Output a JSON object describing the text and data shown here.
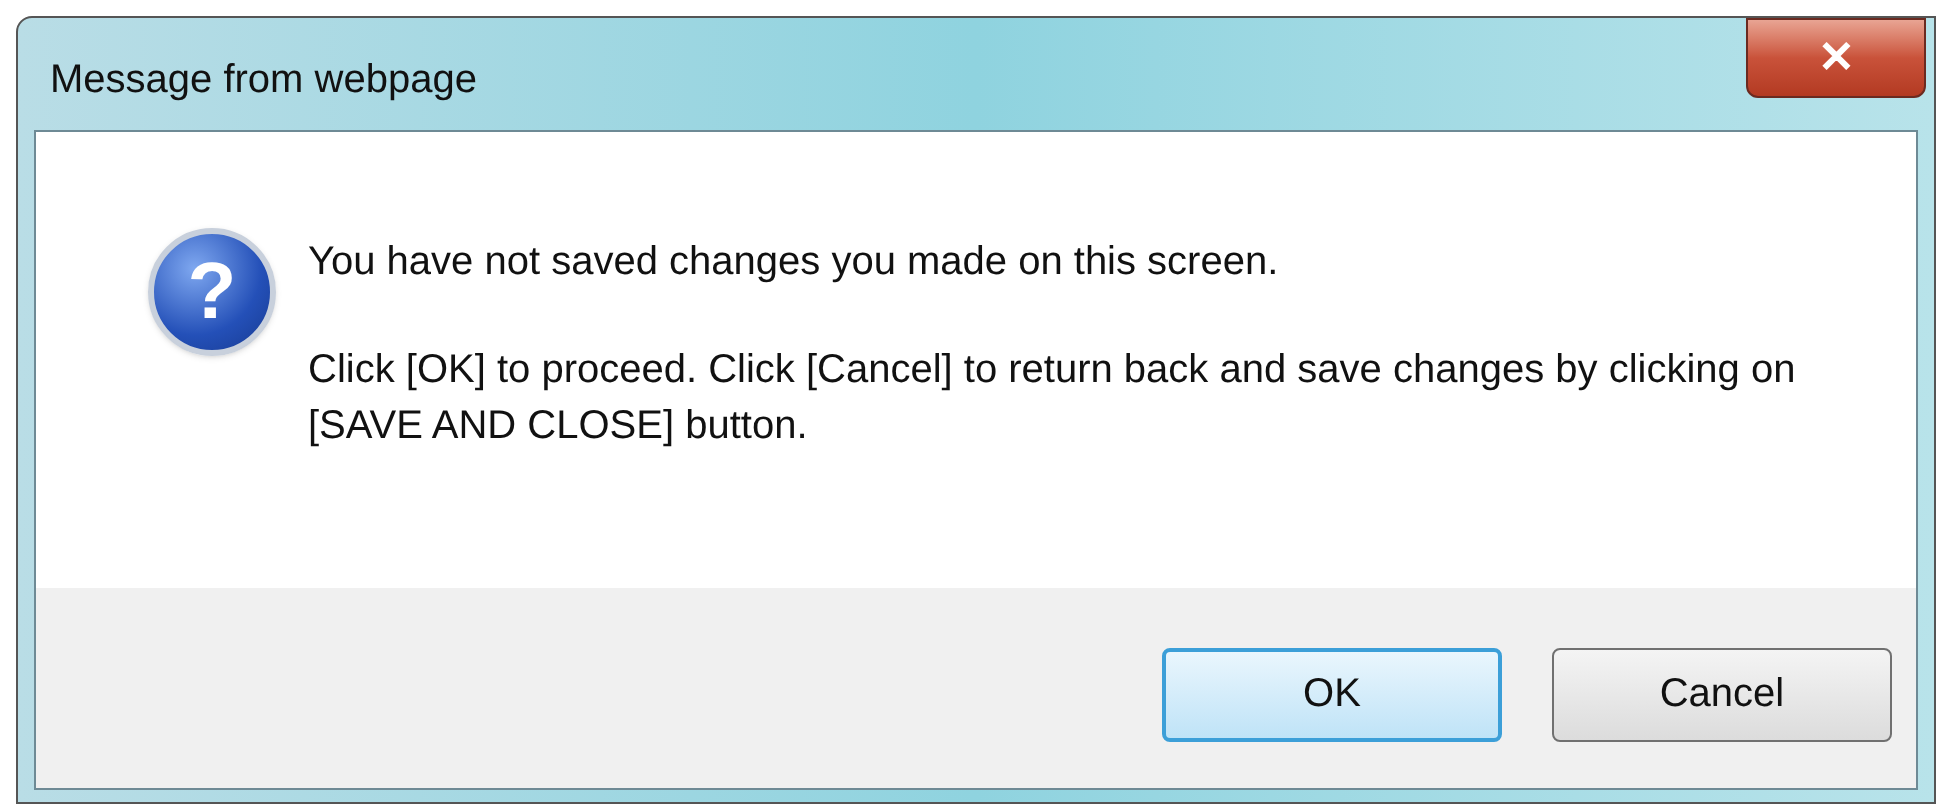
{
  "window": {
    "title": "Message from webpage",
    "close_glyph": "✕"
  },
  "message": {
    "icon": "?",
    "lines": [
      "You have not saved changes you made on this screen.",
      "Click [OK] to proceed. Click [Cancel] to return back and save changes by clicking on [SAVE AND CLOSE] button."
    ]
  },
  "buttons": [
    {
      "label": "OK",
      "selected": true
    },
    {
      "label": "Cancel",
      "selected": false
    }
  ]
}
